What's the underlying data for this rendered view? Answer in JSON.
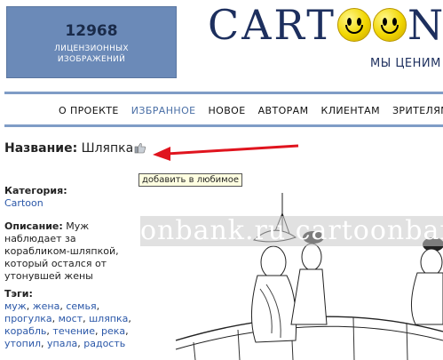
{
  "counter": {
    "number": "12968",
    "caption_line1": "ЛИЦЕНЗИОННЫХ",
    "caption_line2": "ИЗОБРАЖЕНИЙ"
  },
  "logo": {
    "part1": "CART",
    "part2": "N"
  },
  "tagline": "МЫ ЦЕНИМ",
  "nav": {
    "items": [
      "О ПРОЕКТЕ",
      "ИЗБРАННОЕ",
      "НОВОЕ",
      "АВТОРАМ",
      "КЛИЕНТАМ",
      "ЗРИТЕЛЯМ"
    ],
    "active_index": 1
  },
  "title": {
    "label": "Название:",
    "value": "Шляпка"
  },
  "tooltip": "добавить в любимое",
  "category": {
    "label": "Категория:",
    "value": "Cartoon"
  },
  "description": {
    "label": "Описание:",
    "value": "Муж наблюдает за корабликом-шляпкой, который остался от утонувшей жены"
  },
  "tags": {
    "label": "Тэги:",
    "items": [
      "муж",
      "жена",
      "семья",
      "прогулка",
      "мост",
      "шляпка",
      "корабль",
      "течение",
      "река",
      "утопил",
      "упала",
      "радость"
    ]
  },
  "watermark": "onbank.ru  cartoonbank",
  "colors": {
    "accent": "#7f9cc6",
    "counter_bg": "#6b8ab8",
    "logo": "#1d2f5e",
    "link": "#2a57a8",
    "arrow": "#e0141e"
  }
}
